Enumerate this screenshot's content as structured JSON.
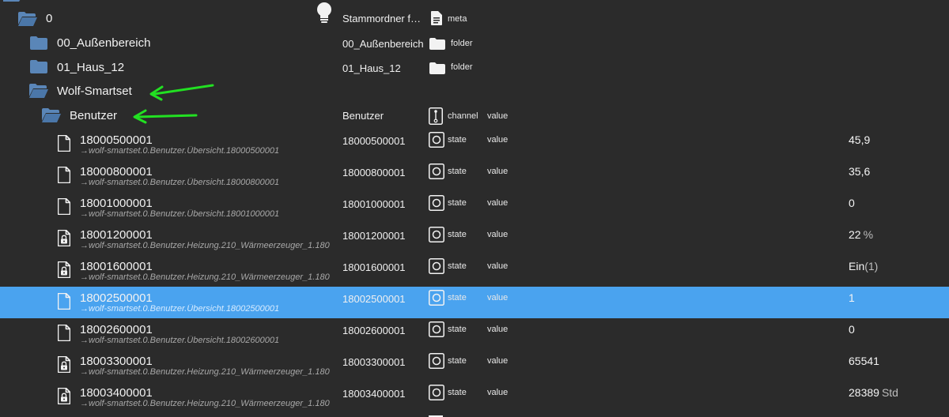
{
  "root": {
    "name": "0",
    "col_name": "Stammordner f…",
    "type": "meta"
  },
  "folders": [
    {
      "name": "00_Außenbereich",
      "col_name": "00_Außenbereich",
      "type": "folder"
    },
    {
      "name": "01_Haus_12",
      "col_name": "01_Haus_12",
      "type": "folder"
    }
  ],
  "smartset": {
    "name": "Wolf-Smartset"
  },
  "channel": {
    "name": "Benutzer",
    "col_name": "Benutzer",
    "type": "channel",
    "role": "value"
  },
  "states": [
    {
      "id": "18000500001",
      "alias": "→wolf-smartset.0.Benutzer.Übersicht.18000500001",
      "col_name": "18000500001",
      "type": "state",
      "role": "value",
      "value": "45,9",
      "unit": "",
      "paren": "",
      "locked": false,
      "selected": false
    },
    {
      "id": "18000800001",
      "alias": "→wolf-smartset.0.Benutzer.Übersicht.18000800001",
      "col_name": "18000800001",
      "type": "state",
      "role": "value",
      "value": "35,6",
      "unit": "",
      "paren": "",
      "locked": false,
      "selected": false
    },
    {
      "id": "18001000001",
      "alias": "→wolf-smartset.0.Benutzer.Übersicht.18001000001",
      "col_name": "18001000001",
      "type": "state",
      "role": "value",
      "value": "0",
      "unit": "",
      "paren": "",
      "locked": false,
      "selected": false
    },
    {
      "id": "18001200001",
      "alias": "→wolf-smartset.0.Benutzer.Heizung.210_Wärmeerzeuger_1.180",
      "col_name": "18001200001",
      "type": "state",
      "role": "value",
      "value": "22",
      "unit": "%",
      "paren": "",
      "locked": true,
      "selected": false
    },
    {
      "id": "18001600001",
      "alias": "→wolf-smartset.0.Benutzer.Heizung.210_Wärmeerzeuger_1.180",
      "col_name": "18001600001",
      "type": "state",
      "role": "value",
      "value": "Ein",
      "unit": "",
      "paren": "(1)",
      "locked": true,
      "selected": false
    },
    {
      "id": "18002500001",
      "alias": "→wolf-smartset.0.Benutzer.Übersicht.18002500001",
      "col_name": "18002500001",
      "type": "state",
      "role": "value",
      "value": "1",
      "unit": "",
      "paren": "",
      "locked": false,
      "selected": true
    },
    {
      "id": "18002600001",
      "alias": "→wolf-smartset.0.Benutzer.Übersicht.18002600001",
      "col_name": "18002600001",
      "type": "state",
      "role": "value",
      "value": "0",
      "unit": "",
      "paren": "",
      "locked": false,
      "selected": false
    },
    {
      "id": "18003300001",
      "alias": "→wolf-smartset.0.Benutzer.Heizung.210_Wärmeerzeuger_1.180",
      "col_name": "18003300001",
      "type": "state",
      "role": "value",
      "value": "65541",
      "unit": "",
      "paren": "",
      "locked": true,
      "selected": false
    },
    {
      "id": "18003400001",
      "alias": "→wolf-smartset.0.Benutzer.Heizung.210_Wärmeerzeuger_1.180",
      "col_name": "18003400001",
      "type": "state",
      "role": "value",
      "value": "28389",
      "unit": "Std",
      "paren": "",
      "locked": true,
      "selected": false
    }
  ],
  "colors": {
    "background": "#2b2b2b",
    "folder": "#5a86b8",
    "selected_row": "#4aa3ef",
    "annotation_arrow": "#22e022"
  },
  "icons": {
    "folder_open": "folder-open-icon",
    "folder_closed": "folder-icon",
    "file": "file-icon",
    "file_locked": "file-lock-icon",
    "meta": "lightbulb-icon",
    "channel": "channel-icon",
    "state": "state-circle-icon"
  }
}
